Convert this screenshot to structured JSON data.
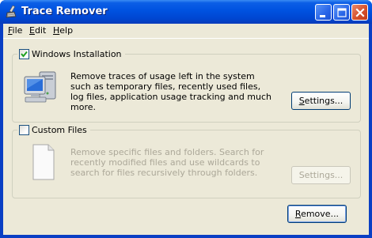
{
  "window": {
    "title": "Trace Remover",
    "icon": "broom-icon"
  },
  "title_buttons": {
    "minimize": "minimize-icon",
    "maximize": "maximize-icon",
    "close": "close-icon"
  },
  "menu": {
    "file_u": "F",
    "file_rest": "ile",
    "edit_u": "E",
    "edit_rest": "dit",
    "help_u": "H",
    "help_rest": "elp"
  },
  "windows_installation": {
    "checked": true,
    "label": "Windows Installation",
    "description": "Remove traces of usage left in the system such as temporary files, recently used files, log files, application usage tracking and much more.",
    "settings_u": "S",
    "settings_rest": "ettings...",
    "icon": "computer-icon"
  },
  "custom_files": {
    "checked": false,
    "label": "Custom Files",
    "description": "Remove specific files and folders. Search for recently modified files and use wildcards to search for files recursively through folders.",
    "settings_label": "Settings...",
    "icon": "document-icon"
  },
  "remove_button": {
    "u": "R",
    "rest": "emove..."
  },
  "colors": {
    "titlebar": "#0052e0",
    "face": "#ece9d8",
    "disabled_text": "#aca899",
    "button_border": "#003c74"
  }
}
